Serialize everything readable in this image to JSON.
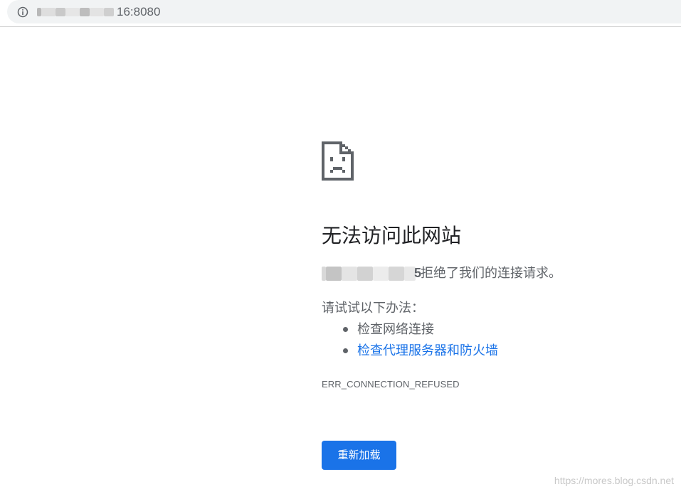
{
  "address_bar": {
    "icon": "info-icon",
    "url_visible_suffix": "16:8080"
  },
  "error_page": {
    "icon": "sad-page-icon",
    "headline": "无法访问此网站",
    "host_visible_suffix": "5",
    "host_message": "拒绝了我们的连接请求。",
    "suggestions_heading": "请试试以下办法：",
    "suggestions": [
      {
        "label": "检查网络连接",
        "is_link": false
      },
      {
        "label": "检查代理服务器和防火墙",
        "is_link": true
      }
    ],
    "error_code": "ERR_CONNECTION_REFUSED",
    "reload_label": "重新加载"
  },
  "watermark": "https://mores.blog.csdn.net",
  "colors": {
    "accent": "#1a73e8",
    "text_primary": "#202124",
    "text_secondary": "#5f6368",
    "omnibox_bg": "#f1f3f4"
  }
}
